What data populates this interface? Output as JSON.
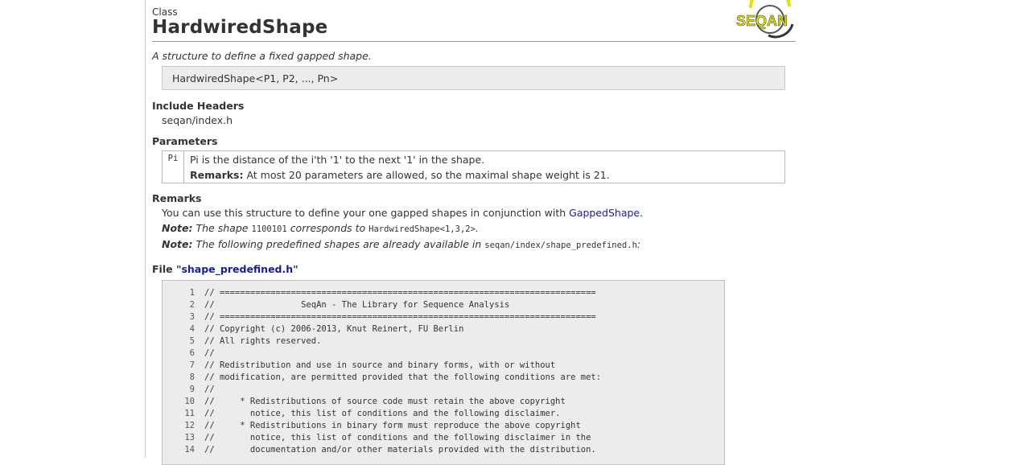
{
  "header": {
    "kind": "Class",
    "title": "HardwiredShape",
    "logo_text": "SEQAN",
    "logo_color": "#e3e100"
  },
  "summary": "A structure to define a fixed gapped shape.",
  "signature": "HardwiredShape<P1, P2, ..., Pn>",
  "include_headers": {
    "heading": "Include Headers",
    "value": "seqan/index.h"
  },
  "parameters": {
    "heading": "Parameters",
    "items": [
      {
        "name": "Pi",
        "description": "Pi is the distance of the i'th '1' to the next '1' in the shape.",
        "remarks_label": "Remarks:",
        "remarks_text": "At most 20 parameters are allowed, so the maximal shape weight is 21."
      }
    ]
  },
  "remarks": {
    "heading": "Remarks",
    "text_before_link": "You can use this structure to define your one gapped shapes in conjunction with ",
    "link_text": "GappedShape",
    "text_after_link": ".",
    "note1": {
      "label": "Note:",
      "text1": "The shape",
      "code1": "1100101",
      "text2": "corresponds to",
      "code2": "HardwiredShape<1,3,2>",
      "text3": "."
    },
    "note2": {
      "label": "Note:",
      "text1": "The following predefined shapes are already available in",
      "code1": "seqan/index/shape_predefined.h",
      "text2": ":"
    }
  },
  "file": {
    "prefix": "File \"",
    "name": "shape_predefined.h",
    "suffix": "\"",
    "lines": [
      {
        "n": "1",
        "text": "// =========================================================================="
      },
      {
        "n": "2",
        "text": "//                 SeqAn - The Library for Sequence Analysis"
      },
      {
        "n": "3",
        "text": "// =========================================================================="
      },
      {
        "n": "4",
        "text": "// Copyright (c) 2006-2013, Knut Reinert, FU Berlin"
      },
      {
        "n": "5",
        "text": "// All rights reserved."
      },
      {
        "n": "6",
        "text": "//"
      },
      {
        "n": "7",
        "text": "// Redistribution and use in source and binary forms, with or without"
      },
      {
        "n": "8",
        "text": "// modification, are permitted provided that the following conditions are met:"
      },
      {
        "n": "9",
        "text": "//"
      },
      {
        "n": "10",
        "text": "//     * Redistributions of source code must retain the above copyright"
      },
      {
        "n": "11",
        "text": "//       notice, this list of conditions and the following disclaimer."
      },
      {
        "n": "12",
        "text": "//     * Redistributions in binary form must reproduce the above copyright"
      },
      {
        "n": "13",
        "text": "//       notice, this list of conditions and the following disclaimer in the"
      },
      {
        "n": "14",
        "text": "//       documentation and/or other materials provided with the distribution."
      }
    ]
  }
}
